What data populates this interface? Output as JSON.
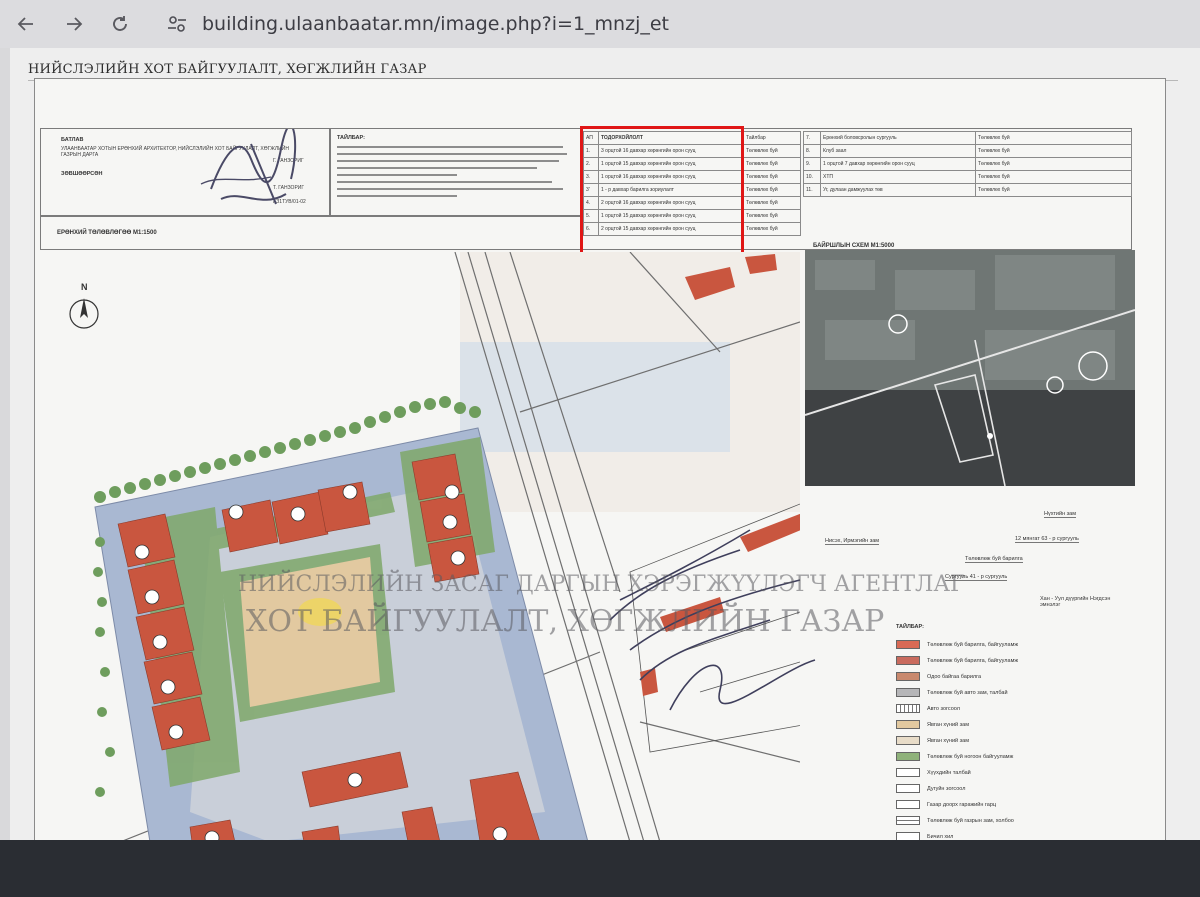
{
  "browser": {
    "url": "building.ulaanbaatar.mn/image.php?i=1_mnzj_et",
    "icons": [
      "back-arrow-icon",
      "forward-arrow-icon",
      "reload-icon",
      "site-settings-icon"
    ]
  },
  "page": {
    "header": "НИЙСЛЭЛИЙН ХОТ БАЙГУУЛАЛТ, ХӨГЖЛИЙН ГАЗАР"
  },
  "sheet": {
    "title_block": {
      "approve_label": "БАТЛАВ",
      "approve_text": "УЛААНБААТАР ХОТЫН ЕРӨНХИЙ АРХИТЕКТОР, НИЙСЛЭЛИЙН ХОТ БАЙГУУЛАЛТ, ХӨГЖЛИЙН ГАЗРЫН ДАРГА",
      "approve_sig": "Г. ГАНЗОРИГ",
      "agree_label": "ЗӨВШӨӨРСӨН",
      "agree_sig": "Т. ГАНЗОРИГ",
      "doc_code": "АЗ1ТУВ/01-02",
      "plan_label": "ЕРӨНХИЙ ТӨЛӨВЛӨГӨӨ  М1:1500",
      "notes_label": "ТАЙЛБАР:",
      "spec_header": {
        "num": "АП",
        "desc": "ТОДОРХОЙЛОЛТ",
        "note": "Тайлбар"
      },
      "spec_rows": [
        {
          "num": "1.",
          "desc": "3 орцтой 16 давхар хөрөнгийн орон сууц",
          "note": "Төлөвлөх буй"
        },
        {
          "num": "2.",
          "desc": "1 орцтой 15 давхар хөрөнгийн орон сууц",
          "note": "Төлөвлөх буй"
        },
        {
          "num": "3.",
          "desc": "1 орцтой 16 давхар хөрөнгийн орон сууц",
          "note": "Төлөвлөх буй"
        },
        {
          "num": "3'",
          "desc": "1 - р давхар барилга зориулалт",
          "note": "Төлөвлөх буй"
        },
        {
          "num": "4.",
          "desc": "2 орцтой 16 давхар хөрөнгийн орон сууц",
          "note": "Төлөвлөх буй"
        },
        {
          "num": "5.",
          "desc": "1 орцтой 15 давхар хөрөнгийн орон сууц",
          "note": "Төлөвлөх буй"
        },
        {
          "num": "6.",
          "desc": "2 орцтой 15 давхар хөрөнгийн орон сууц",
          "note": "Төлөвлөх буй"
        }
      ],
      "side_rows": [
        {
          "num": "7.",
          "desc": "Ерөнхий боловсролын сургууль",
          "note": "Төлөвлөх буй"
        },
        {
          "num": "8.",
          "desc": "Клуб заал",
          "note": "Төлөвлөх буй"
        },
        {
          "num": "9.",
          "desc": "1 орцтой 7 давхар хөрөнгийн орон сууц",
          "note": "Төлөвлөх буй"
        },
        {
          "num": "10.",
          "desc": "ХТП",
          "note": "Төлөвлөх буй"
        },
        {
          "num": "11.",
          "desc": "Уг, дулаан дамжуулах төв",
          "note": "Төлөвлөх буй"
        }
      ],
      "location_label": "БАЙРШЛЫН СХЕМ  М1:5000"
    },
    "location_leaders": [
      "Нүхтийн зам",
      "Нисэх, Ирмэгийн зам",
      "12 мянгат 63 - р сургууль",
      "Төлөвлөж буй барилга",
      "Сургууль 41 - р сургууль",
      "Хан - Уул дүүргийн Нэгдсэн эмнэлэг"
    ],
    "legend": {
      "title": "ТАЙЛБАР:",
      "items": [
        {
          "text": "Төлөвлөж буй барилга, байгууламж",
          "color": "#d96a55"
        },
        {
          "text": "Төлөвлөж буй барилга, байгууламж",
          "color": "#c96b5e"
        },
        {
          "text": "Одоо байгаа барилга",
          "color": "#c9896e"
        },
        {
          "text": "Төлөвлөж буй авто зам, талбай",
          "color": "#b6b6b8"
        },
        {
          "text": "Авто зогсоол",
          "color": "#ffffff"
        },
        {
          "text": "Явган хүний зам",
          "color": "#e2c9a0"
        },
        {
          "text": "Явган хүний зам",
          "color": "#e8dcc8"
        },
        {
          "text": "Төлөвлөж буй ногоон байгууламж",
          "color": "#8fb27a"
        },
        {
          "text": "Хүүхдийн талбай",
          "color": "#ffffff"
        },
        {
          "text": "Дугуйн зогсоол",
          "color": "#ffffff"
        },
        {
          "text": "Газар доорх гаражийн гарц",
          "color": "#ffffff"
        },
        {
          "text": "Төлөвлөж буй газрын зам, холбоо",
          "color": "#ffffff"
        },
        {
          "text": "Бичил хил",
          "color": "#ffffff"
        }
      ]
    },
    "watermark": {
      "line1": "НИЙСЛЭЛИЙН ЗАСАГ ДАРГЫН ХЭРЭГЖҮҮЛЭГЧ АГЕНТЛАГ",
      "line2": "ХОТ БАЙГУУЛАЛТ, ХӨГЖЛИЙН ГАЗАР"
    },
    "north_label": "N"
  },
  "colors": {
    "building": "#c9563f",
    "site_blue": "#a9b8d2",
    "green": "#7fa86a",
    "highlight": "#e01616"
  }
}
